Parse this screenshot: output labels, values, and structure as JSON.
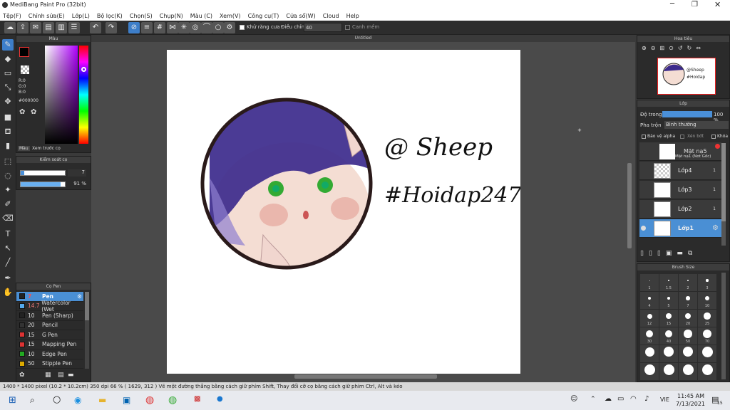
{
  "app": {
    "title": "MediBang Paint Pro (32bit)"
  },
  "menu": [
    "Tệp(F)",
    "Chỉnh sửa(E)",
    "Lớp(L)",
    "Bộ lọc(K)",
    "Chọn(S)",
    "Chụp(N)",
    "Màu (C)",
    "Xem(V)",
    "Công cụ(T)",
    "Cửa sổ(W)",
    "Cloud",
    "Help"
  ],
  "toolbar": {
    "antialias_label": "Khử răng cưa",
    "adjust_label": "Điều chỉnh",
    "adjust_value": "40",
    "snap_label": "Canh mềm"
  },
  "color_panel": {
    "title": "Màu",
    "r": "R:0",
    "g": "G:0",
    "b": "B:0",
    "hex": "#000000",
    "tab1": "Màu",
    "tab2": "Xem trước cọ"
  },
  "brush_control": {
    "title": "Kiểm soát cọ",
    "size": "7",
    "opacity": "91 %"
  },
  "brush_list": {
    "title": "Cọ Pen",
    "items": [
      {
        "size": "7",
        "name": "Pen",
        "color": "#222222"
      },
      {
        "size": "14.7",
        "name": "Watercolor (Wet",
        "color": "#55aaee"
      },
      {
        "size": "10",
        "name": "Pen (Sharp)",
        "color": "#222222"
      },
      {
        "size": "20",
        "name": "Pencil",
        "color": "#333333"
      },
      {
        "size": "15",
        "name": "G Pen",
        "color": "#dd3333"
      },
      {
        "size": "15",
        "name": "Mapping Pen",
        "color": "#dd3333"
      },
      {
        "size": "10",
        "name": "Edge Pen",
        "color": "#22aa22"
      },
      {
        "size": "50",
        "name": "Stipple Pen",
        "color": "#ddaa00"
      }
    ]
  },
  "canvas": {
    "tab": "Untitled",
    "text1": "@ Sheep",
    "text2": "#Hoidap247"
  },
  "navigator": {
    "title": "Hoa tiêu"
  },
  "layers": {
    "title": "Lớp",
    "opacity_label": "Độ trong",
    "opacity_value": "100 %",
    "blend_label": "Pha trộn",
    "blend_value": "Bình thường",
    "protect_alpha": "Bảo vệ alpha",
    "clipping": "Xén bớt",
    "lock": "Khóa",
    "mask_name": "Mặt nạ5",
    "mask_sub": "Mặt nạ1 (Not Gốc)",
    "items": [
      {
        "name": "Lớp4",
        "num": "1"
      },
      {
        "name": "Lớp3",
        "num": "1"
      },
      {
        "name": "Lớp2",
        "num": "1"
      },
      {
        "name": "Lớp1",
        "num": ""
      }
    ]
  },
  "brush_size": {
    "title": "Brush Size",
    "labels": [
      "1",
      "1.5",
      "2",
      "3",
      "4",
      "5",
      "7",
      "10",
      "12",
      "15",
      "20",
      "25",
      "30",
      "40",
      "50",
      "70"
    ]
  },
  "status": {
    "text": "1400 * 1400 pixel   (10.2 * 10.2cm)   350 dpi   66 %   ( 1629, 312 )   Vẽ một đường thẳng bằng cách giữ phím Shift, Thay đổi cỡ cọ bằng cách giữ phím Ctrl, Alt và kéo"
  },
  "taskbar": {
    "time": "11:45 AM",
    "date": "7/13/2021",
    "lang": "VIE",
    "notif": "15"
  },
  "colors": {
    "accent": "#4a90d9",
    "layer_selected": "#4a8fd4"
  }
}
